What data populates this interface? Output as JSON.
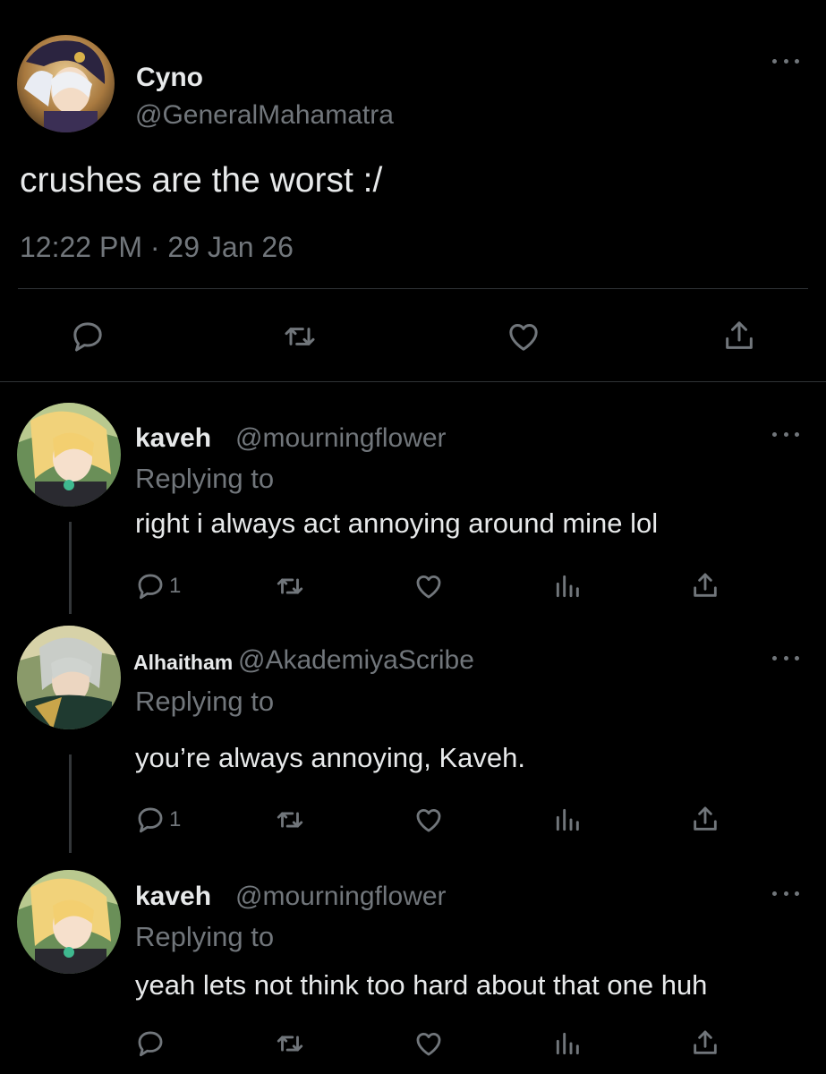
{
  "colors": {
    "background": "#000000",
    "text_primary": "#e7e9ea",
    "text_secondary": "#71767b",
    "divider": "#2f3336",
    "thread_line": "#333639"
  },
  "main_tweet": {
    "author_name": "Cyno",
    "author_handle": "@GeneralMahamatra",
    "text": "crushes are the worst :/",
    "timestamp": "12:22 PM · 29 Jan 26",
    "actions": [
      "reply-icon",
      "retweet-icon",
      "like-icon",
      "share-icon"
    ]
  },
  "replies": [
    {
      "author_name": "kaveh",
      "author_handle": "@mourningflower",
      "replying_label": "Replying to",
      "text": "right i always act annoying around mine lol",
      "reply_count": "1",
      "actions": [
        "reply-icon",
        "retweet-icon",
        "like-icon",
        "views-icon",
        "share-icon"
      ]
    },
    {
      "author_name": "Alhaitham",
      "author_handle": "@AkademiyaScribe",
      "replying_label": "Replying to",
      "text": "you’re always annoying, Kaveh.",
      "reply_count": "1",
      "actions": [
        "reply-icon",
        "retweet-icon",
        "like-icon",
        "views-icon",
        "share-icon"
      ]
    },
    {
      "author_name": "kaveh",
      "author_handle": "@mourningflower",
      "replying_label": "Replying to",
      "text": "yeah lets not think too hard about that one huh",
      "reply_count": "",
      "actions": [
        "reply-icon",
        "retweet-icon",
        "like-icon",
        "views-icon",
        "share-icon"
      ]
    }
  ]
}
